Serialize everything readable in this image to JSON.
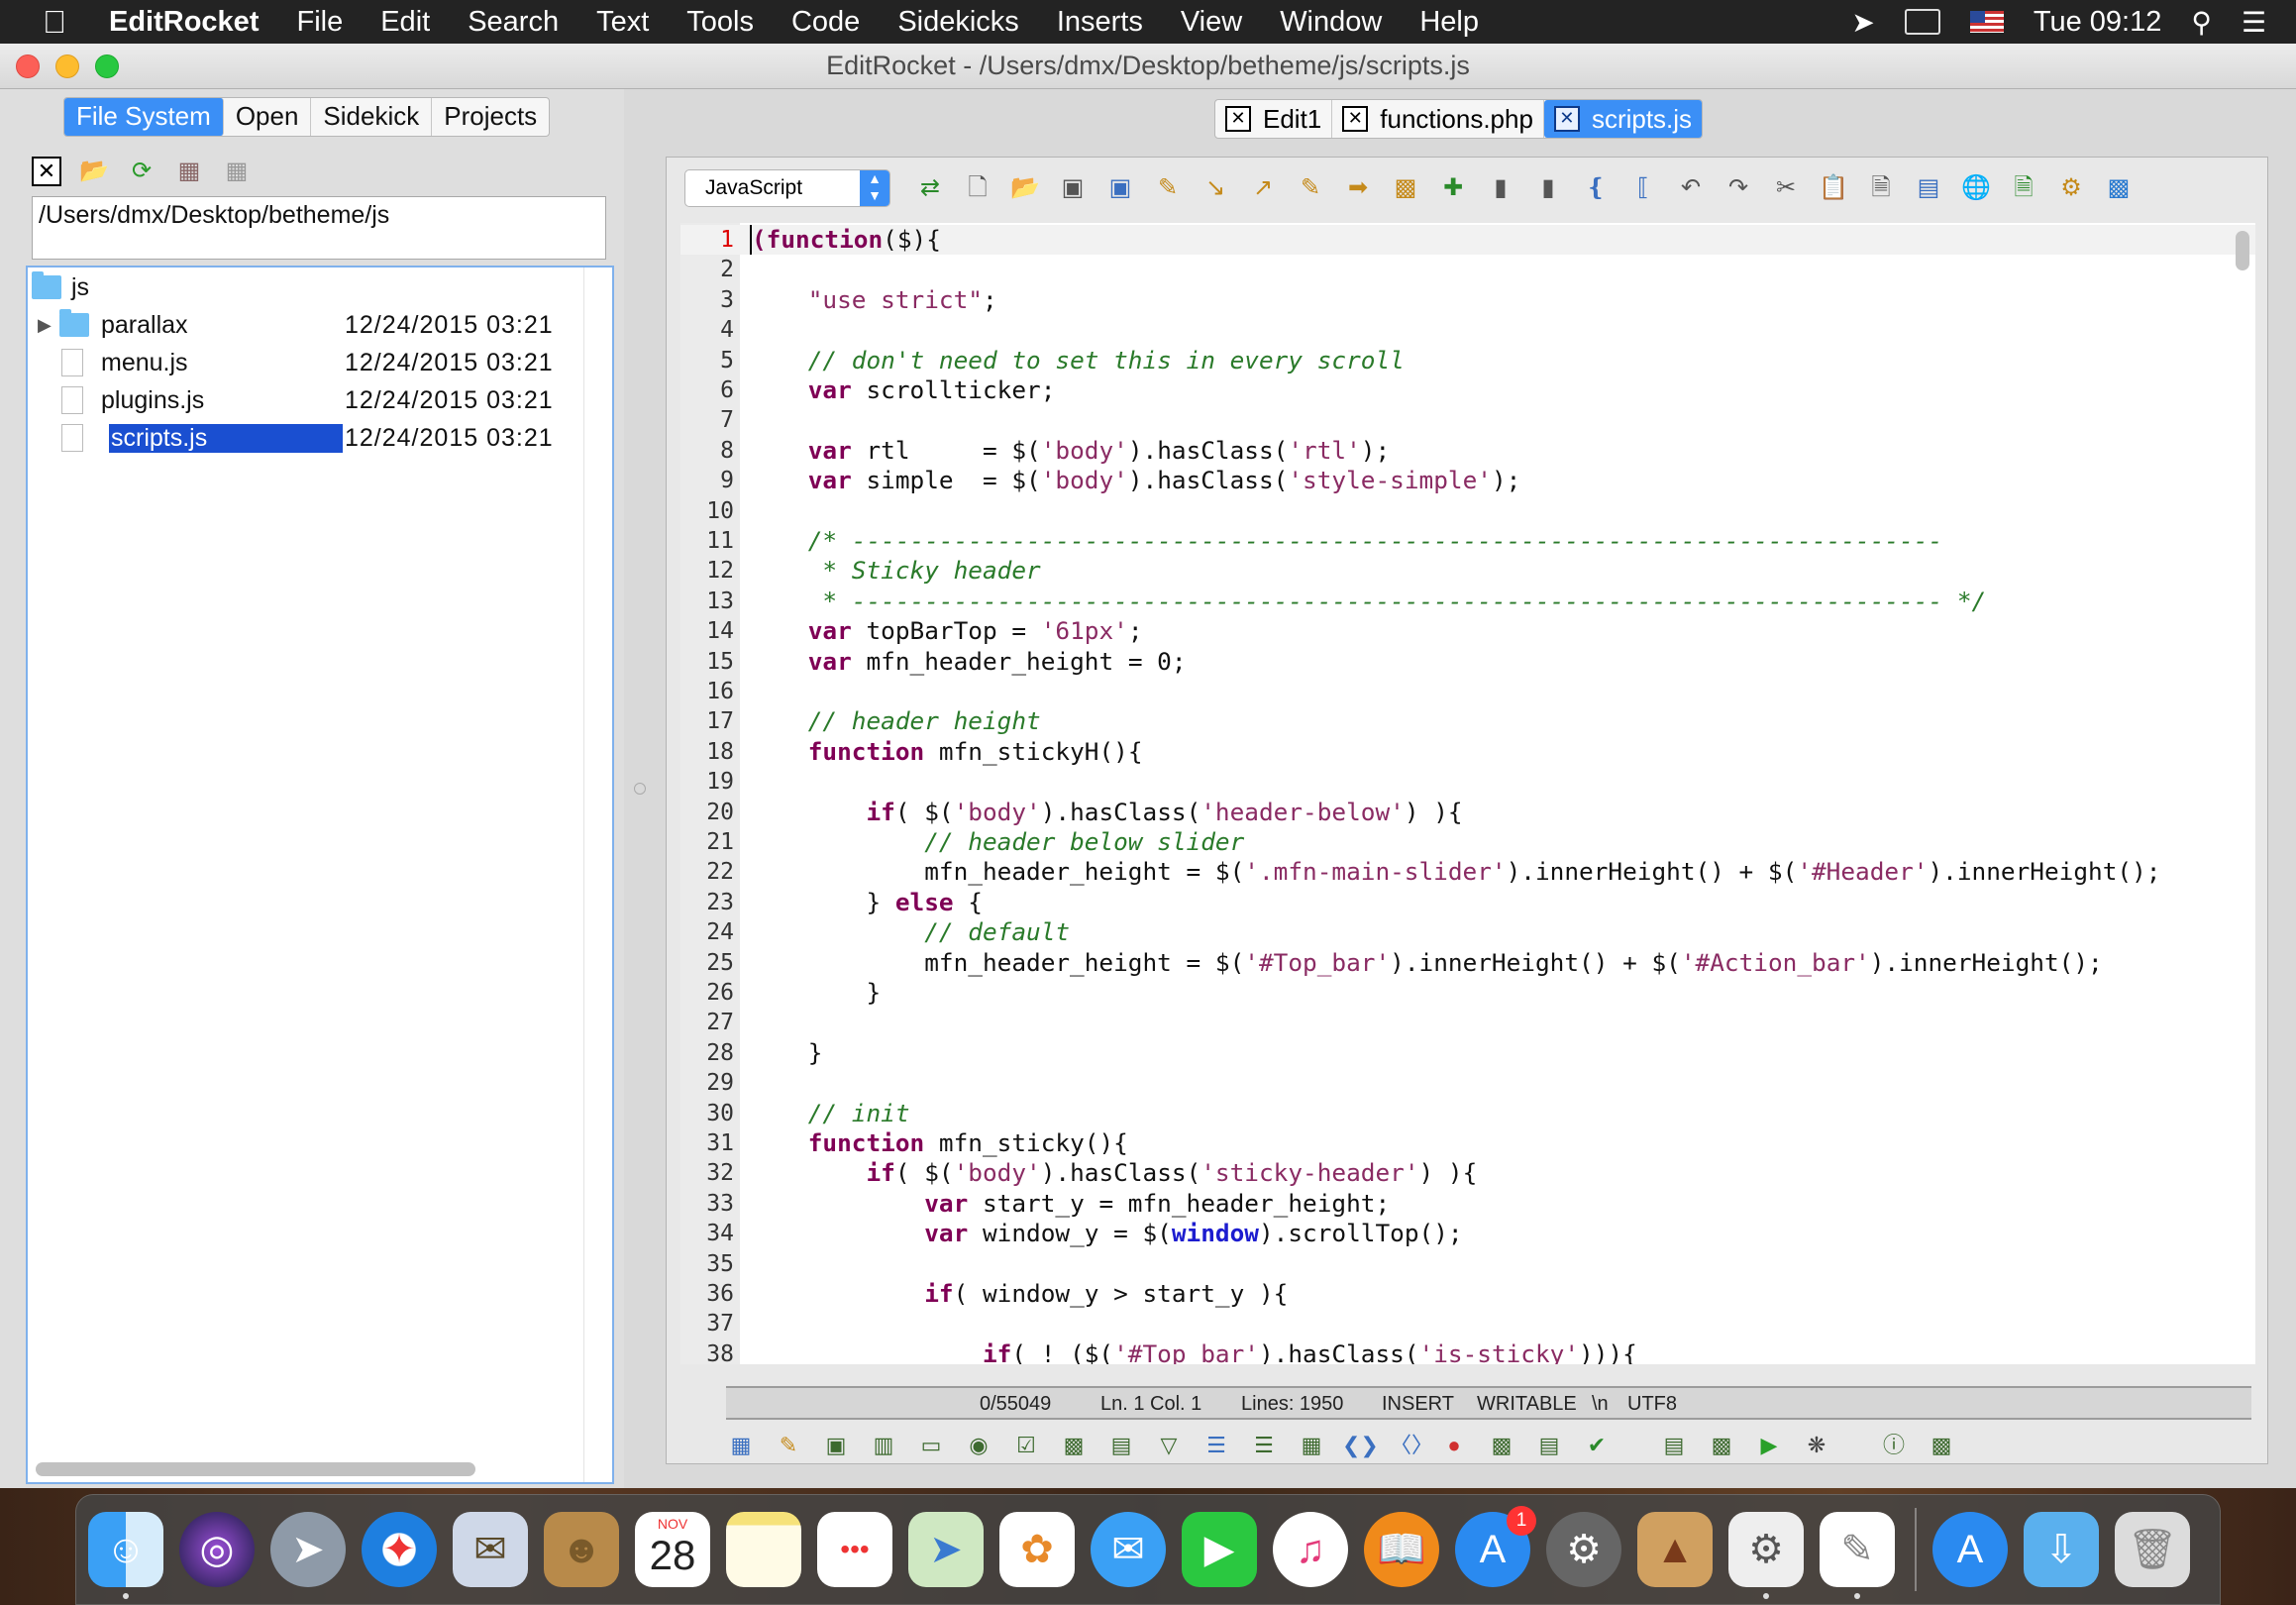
{
  "menubar": {
    "app": "EditRocket",
    "items": [
      "File",
      "Edit",
      "Search",
      "Text",
      "Tools",
      "Code",
      "Sidekicks",
      "Inserts",
      "View",
      "Window",
      "Help"
    ],
    "clock": "Tue 09:12"
  },
  "window": {
    "title": "EditRocket - /Users/dmx/Desktop/betheme/js/scripts.js"
  },
  "left_panel": {
    "tabs": [
      "File System",
      "Open",
      "Sidekick",
      "Projects"
    ],
    "active_tab": "File System",
    "path": "/Users/dmx/Desktop/betheme/js",
    "tree": {
      "root": "js",
      "items": [
        {
          "name": "parallax",
          "type": "folder",
          "date": "12/24/2015 03:21"
        },
        {
          "name": "menu.js",
          "type": "file",
          "date": "12/24/2015 03:21"
        },
        {
          "name": "plugins.js",
          "type": "file",
          "date": "12/24/2015 03:21"
        },
        {
          "name": "scripts.js",
          "type": "file",
          "date": "12/24/2015 03:21",
          "selected": true
        }
      ]
    }
  },
  "editor": {
    "tabs": [
      "Edit1",
      "functions.php",
      "scripts.js"
    ],
    "active_tab": "scripts.js",
    "language": "JavaScript",
    "lines": [
      [
        [
          "kw",
          "(function"
        ],
        [
          "t",
          "($){"
        ]
      ],
      [],
      [
        [
          "t",
          "    "
        ],
        [
          "str",
          "\"use strict\""
        ],
        [
          "t",
          ";"
        ]
      ],
      [],
      [
        [
          "t",
          "    "
        ],
        [
          "cmt",
          "// don't need to set this in every scroll"
        ]
      ],
      [
        [
          "t",
          "    "
        ],
        [
          "kw",
          "var"
        ],
        [
          "t",
          " scrollticker;"
        ]
      ],
      [],
      [
        [
          "t",
          "    "
        ],
        [
          "kw",
          "var"
        ],
        [
          "t",
          " rtl     = $("
        ],
        [
          "str",
          "'body'"
        ],
        [
          "t",
          ").hasClass("
        ],
        [
          "str",
          "'rtl'"
        ],
        [
          "t",
          ");"
        ]
      ],
      [
        [
          "t",
          "    "
        ],
        [
          "kw",
          "var"
        ],
        [
          "t",
          " simple  = $("
        ],
        [
          "str",
          "'body'"
        ],
        [
          "t",
          ").hasClass("
        ],
        [
          "str",
          "'style-simple'"
        ],
        [
          "t",
          ");"
        ]
      ],
      [],
      [
        [
          "t",
          "    "
        ],
        [
          "cmt",
          "/* ---------------------------------------------------------------------------"
        ]
      ],
      [
        [
          "t",
          "    "
        ],
        [
          "cmt",
          " * Sticky header"
        ]
      ],
      [
        [
          "t",
          "    "
        ],
        [
          "cmt",
          " * --------------------------------------------------------------------------- */"
        ]
      ],
      [
        [
          "t",
          "    "
        ],
        [
          "kw",
          "var"
        ],
        [
          "t",
          " topBarTop = "
        ],
        [
          "str",
          "'61px'"
        ],
        [
          "t",
          ";"
        ]
      ],
      [
        [
          "t",
          "    "
        ],
        [
          "kw",
          "var"
        ],
        [
          "t",
          " mfn_header_height = 0;"
        ]
      ],
      [],
      [
        [
          "t",
          "    "
        ],
        [
          "cmt",
          "// header height"
        ]
      ],
      [
        [
          "t",
          "    "
        ],
        [
          "kw",
          "function"
        ],
        [
          "t",
          " mfn_stickyH(){"
        ]
      ],
      [],
      [
        [
          "t",
          "        "
        ],
        [
          "kw",
          "if"
        ],
        [
          "t",
          "( $("
        ],
        [
          "str",
          "'body'"
        ],
        [
          "t",
          ").hasClass("
        ],
        [
          "str",
          "'header-below'"
        ],
        [
          "t",
          ") ){"
        ]
      ],
      [
        [
          "t",
          "            "
        ],
        [
          "cmt",
          "// header below slider"
        ]
      ],
      [
        [
          "t",
          "            mfn_header_height = $("
        ],
        [
          "str",
          "'.mfn-main-slider'"
        ],
        [
          "t",
          ").innerHeight() + $("
        ],
        [
          "str",
          "'#Header'"
        ],
        [
          "t",
          ").innerHeight();"
        ]
      ],
      [
        [
          "t",
          "        } "
        ],
        [
          "kw",
          "else"
        ],
        [
          "t",
          " {"
        ]
      ],
      [
        [
          "t",
          "            "
        ],
        [
          "cmt",
          "// default"
        ]
      ],
      [
        [
          "t",
          "            mfn_header_height = $("
        ],
        [
          "str",
          "'#Top_bar'"
        ],
        [
          "t",
          ").innerHeight() + $("
        ],
        [
          "str",
          "'#Action_bar'"
        ],
        [
          "t",
          ").innerHeight();"
        ]
      ],
      [
        [
          "t",
          "        }"
        ]
      ],
      [],
      [
        [
          "t",
          "    }"
        ]
      ],
      [],
      [
        [
          "t",
          "    "
        ],
        [
          "cmt",
          "// init"
        ]
      ],
      [
        [
          "t",
          "    "
        ],
        [
          "kw",
          "function"
        ],
        [
          "t",
          " mfn_sticky(){"
        ]
      ],
      [
        [
          "t",
          "        "
        ],
        [
          "kw",
          "if"
        ],
        [
          "t",
          "( $("
        ],
        [
          "str",
          "'body'"
        ],
        [
          "t",
          ").hasClass("
        ],
        [
          "str",
          "'sticky-header'"
        ],
        [
          "t",
          ") ){"
        ]
      ],
      [
        [
          "t",
          "            "
        ],
        [
          "kw",
          "var"
        ],
        [
          "t",
          " start_y = mfn_header_height;"
        ]
      ],
      [
        [
          "t",
          "            "
        ],
        [
          "kw",
          "var"
        ],
        [
          "t",
          " window_y = $("
        ],
        [
          "win",
          "window"
        ],
        [
          "t",
          ").scrollTop();"
        ]
      ],
      [],
      [
        [
          "t",
          "            "
        ],
        [
          "kw",
          "if"
        ],
        [
          "t",
          "( window_y > start_y ){"
        ]
      ],
      [],
      [
        [
          "t",
          "                "
        ],
        [
          "kw",
          "if"
        ],
        [
          "t",
          "( ! ($("
        ],
        [
          "str",
          "'#Top_bar'"
        ],
        [
          "t",
          ").hasClass("
        ],
        [
          "str",
          "'is-sticky'"
        ],
        [
          "t",
          "))){"
        ]
      ]
    ],
    "status": {
      "position": "0/55049",
      "linecol": "Ln. 1 Col. 1",
      "lines": "Lines: 1950",
      "mode": "INSERT",
      "writable": "WRITABLE",
      "eol": "\\n",
      "encoding": "UTF8"
    }
  },
  "dock": {
    "apps": [
      "Finder",
      "Siri",
      "Launchpad",
      "Safari",
      "Mail",
      "Contacts",
      "Calendar",
      "Notes",
      "Reminders",
      "Maps",
      "Photos",
      "Messages",
      "FaceTime",
      "iTunes",
      "iBooks",
      "App Store",
      "System Preferences",
      "Instruments",
      "Script Editor",
      "TextEdit"
    ],
    "calendar": {
      "month": "NOV",
      "day": "28"
    },
    "app_store_badge": "1",
    "stacks": [
      "Applications",
      "Downloads",
      "Trash"
    ]
  }
}
